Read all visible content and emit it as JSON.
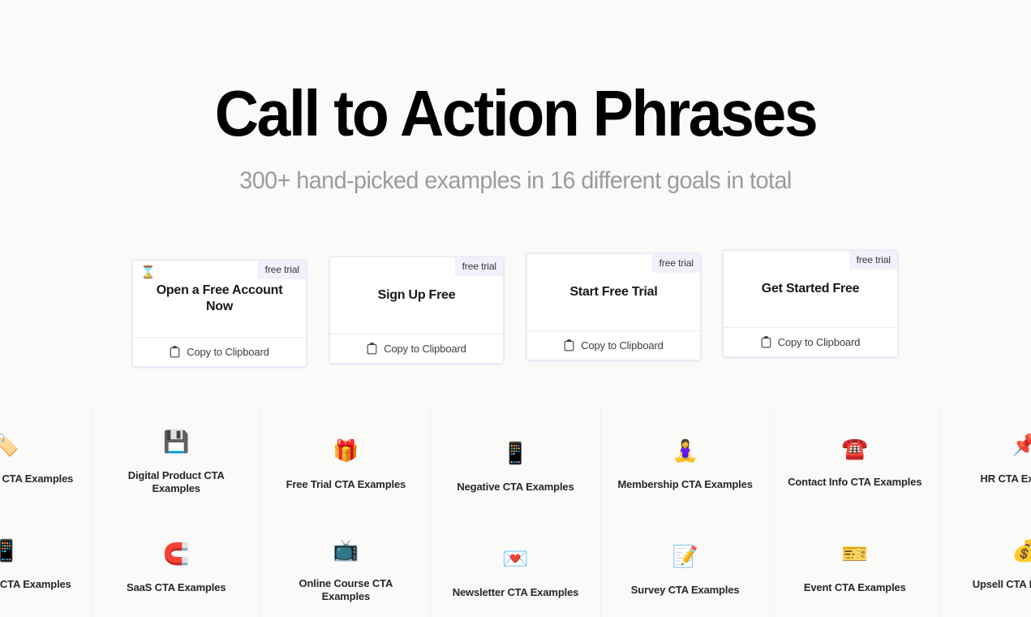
{
  "hero": {
    "title": "Call to Action Phrases",
    "subtitle": "300+ hand-picked examples in 16 different goals in total"
  },
  "copy_label": "Copy to Clipboard",
  "cards": [
    {
      "badge": "free trial",
      "emoji": "⌛",
      "emoji_name": "hourglass-emoji",
      "phrase": "Open a Free Account Now"
    },
    {
      "badge": "free trial",
      "emoji": "",
      "emoji_name": "",
      "phrase": "Sign Up Free"
    },
    {
      "badge": "free trial",
      "emoji": "",
      "emoji_name": "",
      "phrase": "Start Free Trial"
    },
    {
      "badge": "free trial",
      "emoji": "",
      "emoji_name": "",
      "phrase": "Get Started Free"
    }
  ],
  "categories": [
    {
      "label": "eCommerce CTA Examples",
      "emoji": "🏷️",
      "emoji_name": "label-tag-emoji"
    },
    {
      "label": "Digital Product CTA Examples",
      "emoji": "💾",
      "emoji_name": "floppy-disk-emoji"
    },
    {
      "label": "Free Trial CTA Examples",
      "emoji": "🎁",
      "emoji_name": "gift-emoji"
    },
    {
      "label": "Negative CTA Examples",
      "emoji": "📱",
      "emoji_name": "mobile-phone-emoji"
    },
    {
      "label": "Membership CTA Examples",
      "emoji": "🧘‍♀️",
      "emoji_name": "person-lotus-position-emoji"
    },
    {
      "label": "Contact Info CTA Examples",
      "emoji": "☎️",
      "emoji_name": "telephone-emoji"
    },
    {
      "label": "HR CTA Examples",
      "emoji": "📌",
      "emoji_name": "pushpin-note-emoji"
    },
    {
      "label": "Mobile App CTA Examples",
      "emoji": "📱",
      "emoji_name": "mobile-phone-emoji"
    },
    {
      "label": "SaaS CTA Examples",
      "emoji": "🧲",
      "emoji_name": "magnet-emoji"
    },
    {
      "label": "Online Course CTA Examples",
      "emoji": "📺",
      "emoji_name": "television-emoji"
    },
    {
      "label": "Newsletter CTA Examples",
      "emoji": "💌",
      "emoji_name": "love-letter-emoji"
    },
    {
      "label": "Survey CTA Examples",
      "emoji": "📝",
      "emoji_name": "memo-emoji"
    },
    {
      "label": "Event CTA Examples",
      "emoji": "🎫",
      "emoji_name": "ticket-emoji"
    },
    {
      "label": "Upsell CTA Examples",
      "emoji": "💰",
      "emoji_name": "money-bag-emoji"
    }
  ],
  "colors": {
    "page_bg": "#FAFAF9",
    "card_bg": "#FFFFFF",
    "card_border": "#EDE7F6",
    "badge_bg": "#F4F0FB",
    "title": "#000000",
    "subtitle": "#9B9B9B",
    "tile_label": "#27272E",
    "grid_line": "#F1F1F0"
  }
}
